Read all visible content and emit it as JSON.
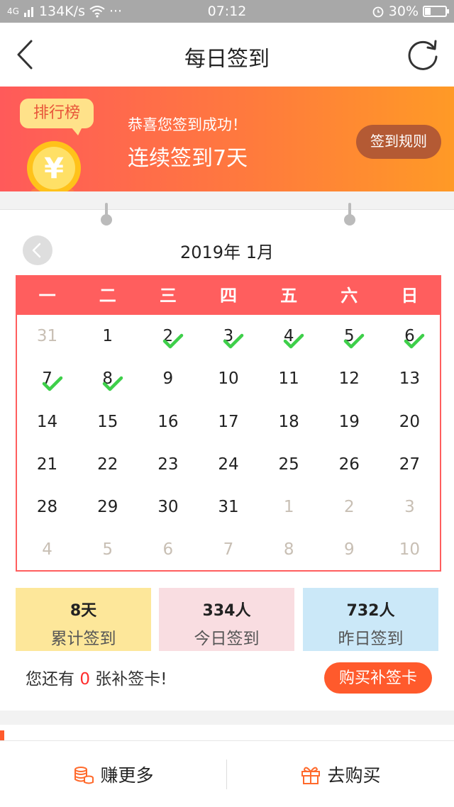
{
  "status_bar": {
    "network": "4G",
    "speed": "134K/s",
    "dots": "···",
    "time": "07:12",
    "battery": "30%",
    "battery_level": 0.3
  },
  "header": {
    "title": "每日签到",
    "back_icon": "back-arrow-icon",
    "refresh_icon": "refresh-icon"
  },
  "banner": {
    "rank_label": "排行榜",
    "message": "恭喜您签到成功！",
    "streak": "连续签到7天",
    "rules_button": "签到规则",
    "colors": {
      "from": "#ff5a5a",
      "to": "#ff9a26"
    }
  },
  "calendar": {
    "month_title": "2019年 1月",
    "weekdays": [
      "一",
      "二",
      "三",
      "四",
      "五",
      "六",
      "日"
    ],
    "weeks": [
      [
        {
          "d": "31",
          "other": true,
          "checked": false
        },
        {
          "d": "1",
          "other": false,
          "checked": false
        },
        {
          "d": "2",
          "other": false,
          "checked": true
        },
        {
          "d": "3",
          "other": false,
          "checked": true
        },
        {
          "d": "4",
          "other": false,
          "checked": true
        },
        {
          "d": "5",
          "other": false,
          "checked": true
        },
        {
          "d": "6",
          "other": false,
          "checked": true
        }
      ],
      [
        {
          "d": "7",
          "other": false,
          "checked": true
        },
        {
          "d": "8",
          "other": false,
          "checked": true
        },
        {
          "d": "9",
          "other": false,
          "checked": false
        },
        {
          "d": "10",
          "other": false,
          "checked": false
        },
        {
          "d": "11",
          "other": false,
          "checked": false
        },
        {
          "d": "12",
          "other": false,
          "checked": false
        },
        {
          "d": "13",
          "other": false,
          "checked": false
        }
      ],
      [
        {
          "d": "14",
          "other": false,
          "checked": false
        },
        {
          "d": "15",
          "other": false,
          "checked": false
        },
        {
          "d": "16",
          "other": false,
          "checked": false
        },
        {
          "d": "17",
          "other": false,
          "checked": false
        },
        {
          "d": "18",
          "other": false,
          "checked": false
        },
        {
          "d": "19",
          "other": false,
          "checked": false
        },
        {
          "d": "20",
          "other": false,
          "checked": false
        }
      ],
      [
        {
          "d": "21",
          "other": false,
          "checked": false
        },
        {
          "d": "22",
          "other": false,
          "checked": false
        },
        {
          "d": "23",
          "other": false,
          "checked": false
        },
        {
          "d": "24",
          "other": false,
          "checked": false
        },
        {
          "d": "25",
          "other": false,
          "checked": false
        },
        {
          "d": "26",
          "other": false,
          "checked": false
        },
        {
          "d": "27",
          "other": false,
          "checked": false
        }
      ],
      [
        {
          "d": "28",
          "other": false,
          "checked": false
        },
        {
          "d": "29",
          "other": false,
          "checked": false
        },
        {
          "d": "30",
          "other": false,
          "checked": false
        },
        {
          "d": "31",
          "other": false,
          "checked": false
        },
        {
          "d": "1",
          "other": true,
          "checked": false
        },
        {
          "d": "2",
          "other": true,
          "checked": false
        },
        {
          "d": "3",
          "other": true,
          "checked": false
        }
      ],
      [
        {
          "d": "4",
          "other": true,
          "checked": false
        },
        {
          "d": "5",
          "other": true,
          "checked": false
        },
        {
          "d": "6",
          "other": true,
          "checked": false
        },
        {
          "d": "7",
          "other": true,
          "checked": false
        },
        {
          "d": "8",
          "other": true,
          "checked": false
        },
        {
          "d": "9",
          "other": true,
          "checked": false
        },
        {
          "d": "10",
          "other": true,
          "checked": false
        }
      ]
    ],
    "accent_color": "#ff5e5e",
    "check_color": "#3ecf4a"
  },
  "stats": [
    {
      "value": "8天",
      "label": "累计签到",
      "bg": "#fde79a"
    },
    {
      "value": "334人",
      "label": "今日签到",
      "bg": "#f9dde1"
    },
    {
      "value": "732人",
      "label": "昨日签到",
      "bg": "#cbe8f8"
    }
  ],
  "makeup": {
    "prefix": "您还有 ",
    "count": "0",
    "suffix": " 张补签卡!",
    "buy_button": "购买补签卡"
  },
  "bottom_tabs": [
    {
      "label": "赚更多",
      "icon": "coin-stack-icon"
    },
    {
      "label": "去购买",
      "icon": "gift-icon"
    }
  ]
}
